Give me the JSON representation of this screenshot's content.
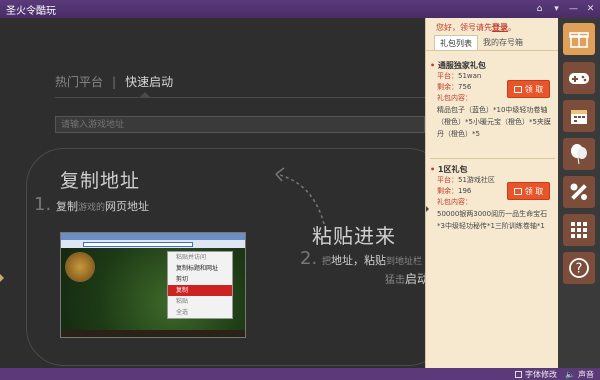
{
  "app": {
    "title": "圣火令酷玩"
  },
  "window_controls": [
    "home-icon",
    "menu-icon",
    "minimize-icon",
    "close-icon"
  ],
  "main": {
    "tabs": [
      {
        "label": "热门平台",
        "active": false
      },
      {
        "label": "快速启动",
        "active": true
      }
    ],
    "tab_separator": "|",
    "url_input": {
      "placeholder": "请输入游戏地址",
      "value": ""
    },
    "step1": {
      "title": "复制地址",
      "number": "1.",
      "sub_prefix": "复制",
      "sub_small": "游戏的",
      "sub_highlight": "网页地址"
    },
    "step2": {
      "title": "粘贴进来",
      "number": "2.",
      "sub_small1": "把",
      "sub_highlight1": "地址",
      "sub_sep": "，",
      "sub_highlight2": "粘贴",
      "sub_small2": "到地址栏",
      "line2_small": "猛击",
      "line2_highlight": "启动"
    },
    "context_menu": [
      {
        "label": "粘贴并访问",
        "state": "normal"
      },
      {
        "label": "复制标题和网址",
        "state": "dark"
      },
      {
        "label": "剪切",
        "state": "dark"
      },
      {
        "label": "复制",
        "state": "selected"
      },
      {
        "label": "粘贴",
        "state": "normal"
      },
      {
        "label": "全选",
        "state": "normal"
      }
    ]
  },
  "panel": {
    "greeting": "您好，领号请先",
    "login_link": "登录",
    "greeting_end": "。",
    "tabs": [
      {
        "label": "礼包列表",
        "active": true
      },
      {
        "label": "我的存号箱",
        "active": false
      }
    ],
    "gifts": [
      {
        "title": "通服独家礼包",
        "platform_label": "平台：",
        "platform": "51wan",
        "remaining_label": "剩余：",
        "remaining": "756",
        "content_label": "礼包内容：",
        "content": "精品包子（蓝色）*10中级轻功卷轴（橙色）*5小暖元宝（橙色）*5夹膜丹（橙色）*5",
        "button": "领 取"
      },
      {
        "title": "1区礼包",
        "platform_label": "平台：",
        "platform": "51游戏社区",
        "remaining_label": "剩余：",
        "remaining": "196",
        "content_label": "礼包内容：",
        "content": "50000银两3000阅历一品生命宝石*3中级轻功秘传*1三阶训练卷轴*1",
        "button": "领 取"
      }
    ]
  },
  "sidebar_icons": [
    {
      "name": "gift-icon",
      "active": true
    },
    {
      "name": "gamepad-icon",
      "active": false
    },
    {
      "name": "calendar-icon",
      "active": false
    },
    {
      "name": "balloon-icon",
      "active": false
    },
    {
      "name": "tools-icon",
      "active": false
    },
    {
      "name": "grid-icon",
      "active": false
    },
    {
      "name": "help-icon",
      "active": false
    }
  ],
  "statusbar": {
    "font_fix": "字体修改",
    "sound": "声音"
  },
  "colors": {
    "titlebar": "#4a2d67",
    "panel_bg": "#f6e9d0",
    "accent_red": "#c0392b",
    "button_orange": "#e8552a"
  }
}
